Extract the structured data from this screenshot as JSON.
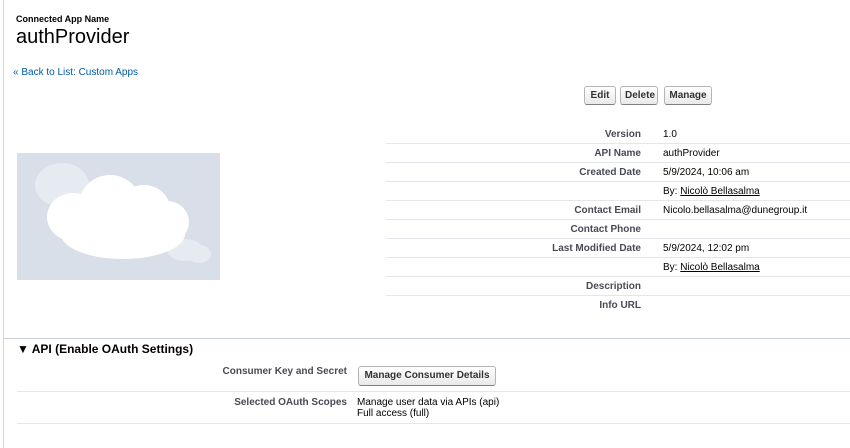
{
  "header": {
    "label": "Connected App Name",
    "title": "authProvider",
    "back_link": "« Back to List: Custom Apps"
  },
  "toolbar": {
    "edit_label": "Edit",
    "delete_label": "Delete",
    "manage_label": "Manage"
  },
  "details": {
    "version": {
      "label": "Version",
      "value": "1.0"
    },
    "api_name": {
      "label": "API Name",
      "value": "authProvider"
    },
    "created_date": {
      "label": "Created Date",
      "value": "5/9/2024, 10:06 am",
      "by_prefix": "By:",
      "by_user": "Nicolò Bellasalma"
    },
    "contact_email": {
      "label": "Contact Email",
      "value": "Nicolo.bellasalma@dunegroup.it"
    },
    "contact_phone": {
      "label": "Contact Phone",
      "value": ""
    },
    "last_modified": {
      "label": "Last Modified Date",
      "value": "5/9/2024, 12:02 pm",
      "by_prefix": "By:",
      "by_user": "Nicolò Bellasalma"
    },
    "description": {
      "label": "Description",
      "value": ""
    },
    "info_url": {
      "label": "Info URL",
      "value": ""
    }
  },
  "api_section": {
    "toggle_icon": "triangle-down-icon",
    "title": "▼ API (Enable OAuth Settings)",
    "consumer_label": "Consumer Key and Secret",
    "consumer_button": "Manage Consumer Details",
    "scopes_label": "Selected OAuth Scopes",
    "scopes": [
      "Manage user data via APIs (api)",
      "Full access (full)"
    ]
  },
  "logo": {
    "icon": "salesforce-cloud-placeholder-icon"
  },
  "colors": {
    "link": "#015ba7",
    "label": "#4a4a56",
    "logo_bg": "#d8dfe8"
  }
}
